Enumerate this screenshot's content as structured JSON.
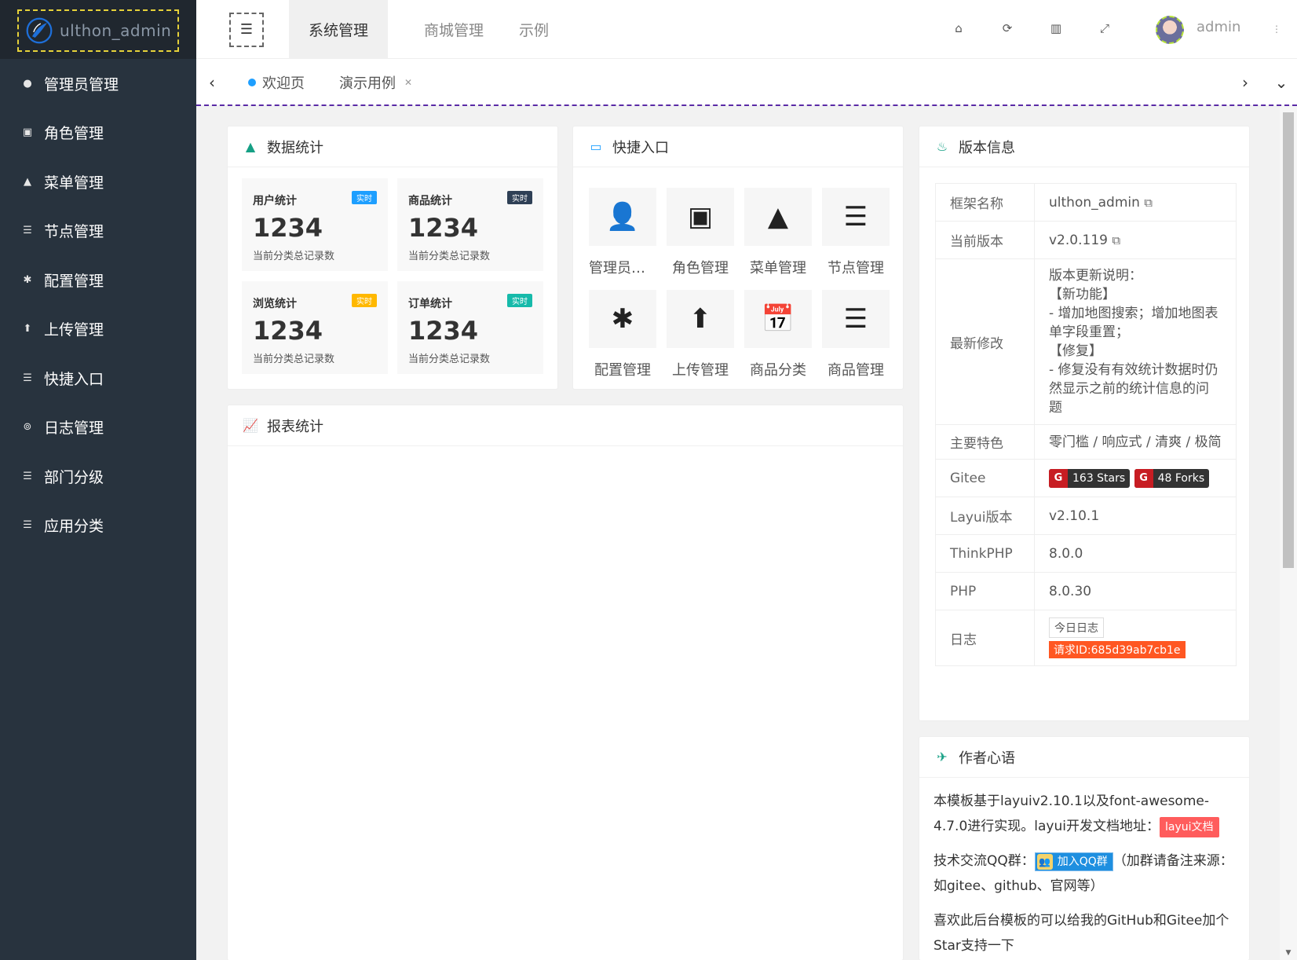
{
  "app": {
    "logo_text": "ulthon_admin"
  },
  "sidebar": {
    "items": [
      {
        "label": "管理员管理",
        "icon": "user-icon"
      },
      {
        "label": "角色管理",
        "icon": "database-icon"
      },
      {
        "label": "菜单管理",
        "icon": "tree-icon"
      },
      {
        "label": "节点管理",
        "icon": "list-icon"
      },
      {
        "label": "配置管理",
        "icon": "asterisk-icon"
      },
      {
        "label": "上传管理",
        "icon": "upload-icon"
      },
      {
        "label": "快捷入口",
        "icon": "list-icon"
      },
      {
        "label": "日志管理",
        "icon": "log-icon"
      },
      {
        "label": "部门分级",
        "icon": "list-icon"
      },
      {
        "label": "应用分类",
        "icon": "list-icon"
      }
    ]
  },
  "header": {
    "nav": [
      "系统管理",
      "商城管理",
      "示例"
    ],
    "user_name": "admin"
  },
  "tabs": {
    "items": [
      "欢迎页",
      "演示用例"
    ]
  },
  "stats": {
    "title": "数据统计",
    "cards": [
      {
        "name": "用户统计",
        "badge": "实时",
        "badge_color": "#1e9fff",
        "value": "1234",
        "desc": "当前分类总记录数"
      },
      {
        "name": "商品统计",
        "badge": "实时",
        "badge_color": "#2f4056",
        "value": "1234",
        "desc": "当前分类总记录数"
      },
      {
        "name": "浏览统计",
        "badge": "实时",
        "badge_color": "#ffb800",
        "value": "1234",
        "desc": "当前分类总记录数"
      },
      {
        "name": "订单统计",
        "badge": "实时",
        "badge_color": "#16baaa",
        "value": "1234",
        "desc": "当前分类总记录数"
      }
    ]
  },
  "quick": {
    "title": "快捷入口",
    "items": [
      {
        "label": "管理员管理",
        "icon": "user-icon"
      },
      {
        "label": "角色管理",
        "icon": "database-icon"
      },
      {
        "label": "菜单管理",
        "icon": "tree-icon"
      },
      {
        "label": "节点管理",
        "icon": "list-icon"
      },
      {
        "label": "配置管理",
        "icon": "asterisk-icon"
      },
      {
        "label": "上传管理",
        "icon": "arrow-up-icon"
      },
      {
        "label": "商品分类",
        "icon": "calendar-check-icon"
      },
      {
        "label": "商品管理",
        "icon": "list-icon"
      }
    ]
  },
  "report": {
    "title": "报表统计"
  },
  "version": {
    "title": "版本信息",
    "rows": [
      {
        "k": "框架名称",
        "v": "ulthon_admin"
      },
      {
        "k": "当前版本",
        "v": "v2.0.119"
      },
      {
        "k": "最新修改",
        "v": "版本更新说明：\n【新功能】\n- 增加地图搜索；增加地图表单字段重置；\n【修复】\n- 修复没有有效统计数据时仍然显示之前的统计信息的问题"
      },
      {
        "k": "主要特色",
        "v": "零门槛 / 响应式 / 清爽 / 极简"
      },
      {
        "k": "Gitee",
        "stars": "163 Stars",
        "forks": "48 Forks"
      },
      {
        "k": "Layui版本",
        "v": "v2.10.1"
      },
      {
        "k": "ThinkPHP",
        "v": "8.0.0"
      },
      {
        "k": "PHP",
        "v": "8.0.30"
      },
      {
        "k": "日志",
        "log_btn": "今日日志",
        "request_id": "请求ID:685d39ab7cb1e"
      }
    ]
  },
  "author": {
    "title": "作者心语",
    "p1": "本模板基于layuiv2.10.1以及font-awesome-4.7.0进行实现。layui开发文档地址：",
    "p1_tag": "layui文档",
    "p2a": "技术交流QQ群：",
    "p2_btn": "加入QQ群",
    "p2b": "（加群请备注来源：如gitee、github、官网等）",
    "p3": "喜欢此后台模板的可以给我的GitHub和Gitee加个Star支持一下"
  }
}
